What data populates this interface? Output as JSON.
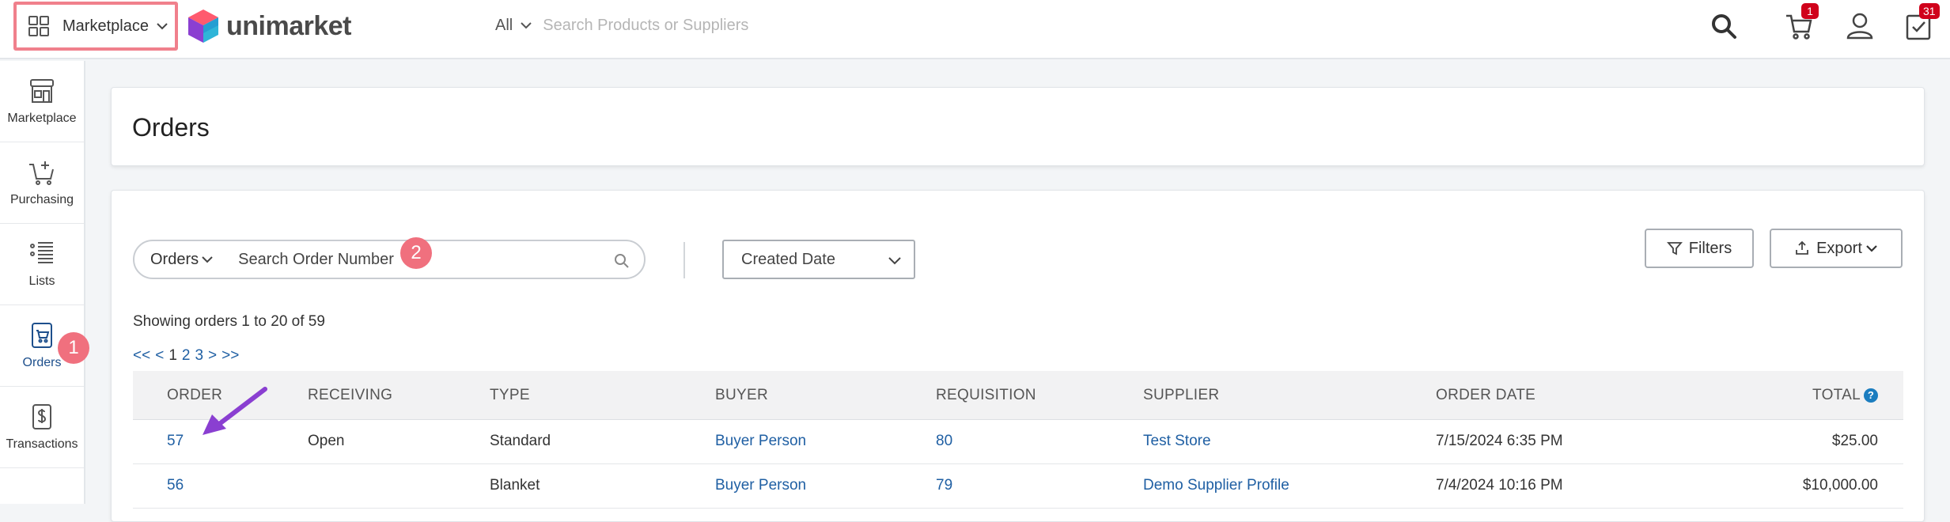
{
  "header": {
    "app_switcher_label": "Marketplace",
    "brand": "unimarket",
    "search_scope": "All",
    "search_placeholder": "Search Products or Suppliers",
    "cart_badge": "1",
    "tasks_badge": "31"
  },
  "sidebar": {
    "items": [
      {
        "label": "Marketplace",
        "icon": "store-icon"
      },
      {
        "label": "Purchasing",
        "icon": "cart-plus-icon"
      },
      {
        "label": "Lists",
        "icon": "list-icon"
      },
      {
        "label": "Orders",
        "icon": "order-doc-icon"
      },
      {
        "label": "Transactions",
        "icon": "transaction-doc-icon"
      }
    ]
  },
  "markers": {
    "sidebar": "1",
    "search": "2"
  },
  "page": {
    "title": "Orders"
  },
  "toolbar": {
    "search_scope": "Orders",
    "search_placeholder": "Search Order Number",
    "date_filter": "Created Date",
    "filters_label": "Filters",
    "export_label": "Export"
  },
  "results": {
    "showing": "Showing orders 1 to 20 of 59",
    "pager": [
      "<<",
      "<",
      "1",
      "2",
      "3",
      ">",
      ">>"
    ]
  },
  "table": {
    "columns": [
      "ORDER",
      "RECEIVING",
      "TYPE",
      "BUYER",
      "REQUISITION",
      "SUPPLIER",
      "ORDER DATE",
      "TOTAL"
    ],
    "rows": [
      {
        "order": "57",
        "receiving": "Open",
        "type": "Standard",
        "buyer": "Buyer Person",
        "requisition": "80",
        "supplier": "Test Store",
        "order_date": "7/15/2024 6:35 PM",
        "total": "$25.00"
      },
      {
        "order": "56",
        "receiving": "",
        "type": "Blanket",
        "buyer": "Buyer Person",
        "requisition": "79",
        "supplier": "Demo Supplier Profile",
        "order_date": "7/4/2024 10:16 PM",
        "total": "$10,000.00"
      }
    ]
  },
  "colors": {
    "accent": "#1f5fa3",
    "marker": "#f0707e",
    "badge": "#d0021b",
    "arrow": "#8a3fd1"
  }
}
